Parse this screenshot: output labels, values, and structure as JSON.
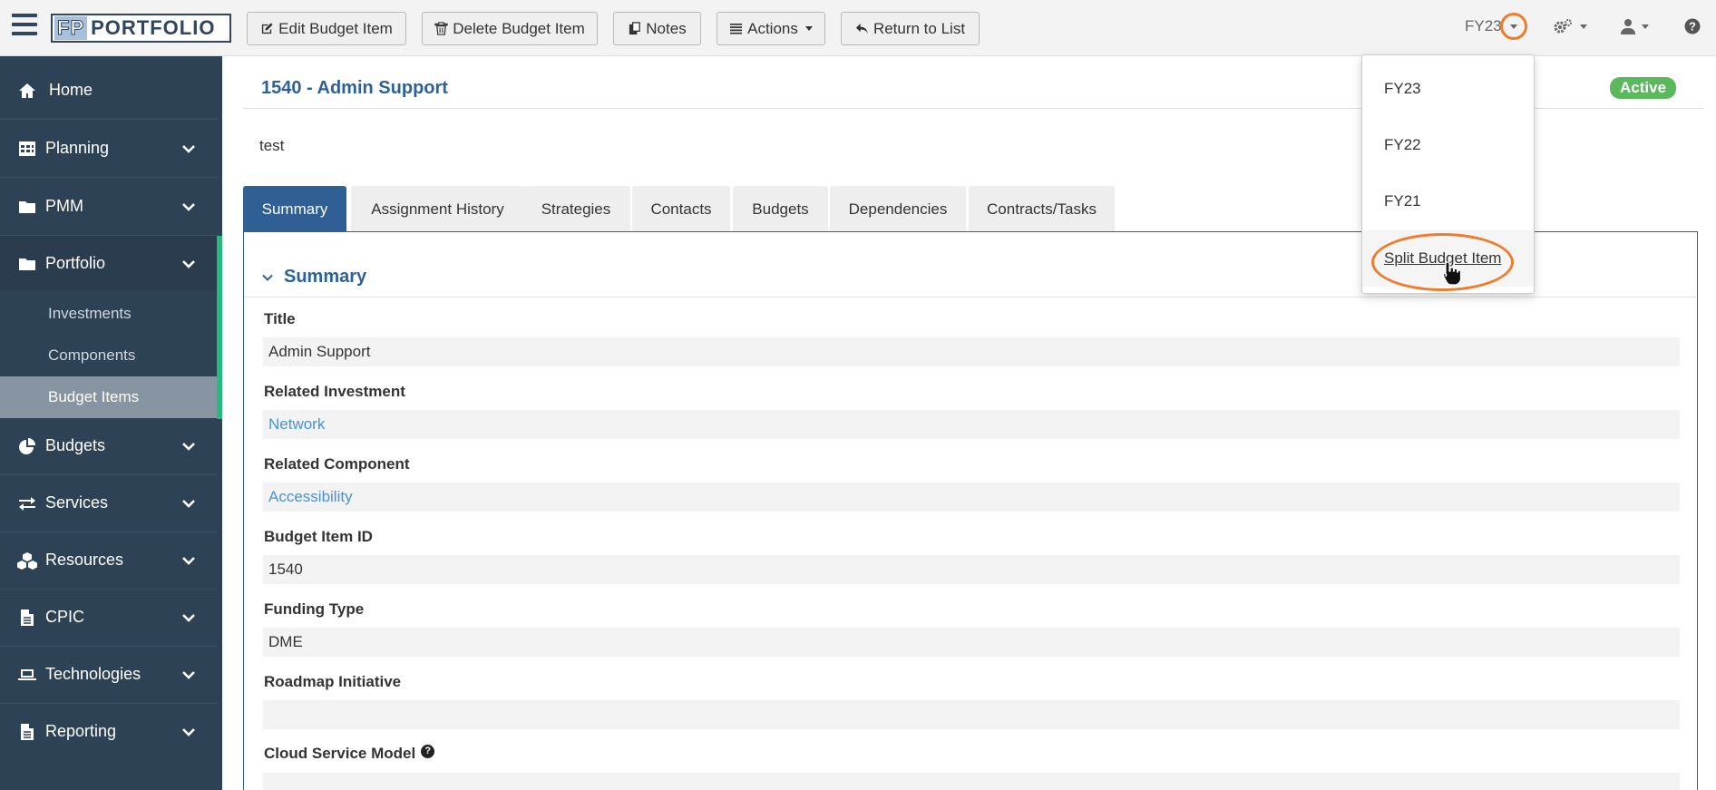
{
  "app": {
    "logo_left": "FP",
    "logo_right": "PORTFOLIO"
  },
  "toolbar": {
    "edit_label": "Edit Budget Item",
    "delete_label": "Delete Budget Item",
    "notes_label": "Notes",
    "actions_label": "Actions",
    "return_label": "Return to List"
  },
  "topbar_right": {
    "fy_label": "FY23"
  },
  "sidebar": {
    "items": [
      {
        "label": "Home",
        "icon": "home-icon"
      },
      {
        "label": "Planning",
        "icon": "table-icon"
      },
      {
        "label": "PMM",
        "icon": "folder-icon"
      },
      {
        "label": "Portfolio",
        "icon": "folder-icon"
      },
      {
        "label": "Budgets",
        "icon": "pie-chart-icon"
      },
      {
        "label": "Services",
        "icon": "exchange-icon"
      },
      {
        "label": "Resources",
        "icon": "cubes-icon"
      },
      {
        "label": "CPIC",
        "icon": "file-icon"
      },
      {
        "label": "Technologies",
        "icon": "laptop-icon"
      },
      {
        "label": "Reporting",
        "icon": "file-icon"
      }
    ],
    "portfolio_sub": [
      "Investments",
      "Components",
      "Budget Items"
    ]
  },
  "page": {
    "title": "1540 - Admin Support",
    "status": "Active",
    "description": "test"
  },
  "tabs": [
    "Summary",
    "Assignment History",
    "Strategies",
    "Contacts",
    "Budgets",
    "Dependencies",
    "Contracts/Tasks"
  ],
  "summary": {
    "heading": "Summary",
    "fields": [
      {
        "label": "Title",
        "value": "Admin Support"
      },
      {
        "label": "Related Investment",
        "value": "Network"
      },
      {
        "label": "Related Component",
        "value": "Accessibility"
      },
      {
        "label": "Budget Item ID",
        "value": "1540"
      },
      {
        "label": "Funding Type",
        "value": "DME"
      },
      {
        "label": "Roadmap Initiative",
        "value": ""
      },
      {
        "label": "Cloud Service Model",
        "value": ""
      }
    ],
    "help_glyph": "?"
  },
  "fy_dropdown": {
    "options": [
      "FY23",
      "FY22",
      "FY21"
    ],
    "action": "Split Budget Item"
  },
  "colors": {
    "sidebar_bg": "#2e4256",
    "accent_blue": "#2f5f95",
    "active_green": "#5cb85c",
    "highlight_orange": "#f07c2b"
  }
}
